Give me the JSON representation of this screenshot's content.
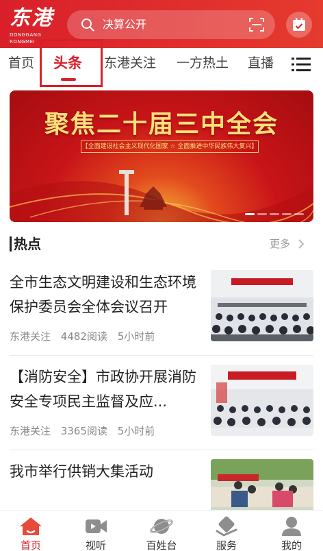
{
  "header": {
    "logo_text": "东港",
    "logo_sub": "DONGGANG RONGMEI",
    "search_placeholder": "决算公开",
    "icons": {
      "search": "search-icon",
      "scan": "scan-icon",
      "calendar": "calendar-icon"
    }
  },
  "tabs": [
    {
      "label": "首页"
    },
    {
      "label": "头条",
      "active": true
    },
    {
      "label": "东港关注"
    },
    {
      "label": "一方热土"
    },
    {
      "label": "直播"
    }
  ],
  "banner": {
    "title": "聚焦二十届三中全会",
    "subtitle": "【全面建设社会主义现代化国家 ☆ 全面推进中华民族伟大复兴】"
  },
  "section": {
    "title": "热点",
    "more": "更多"
  },
  "news": [
    {
      "title": "全市生态文明建设和生态环境保护委员会全体会议召开",
      "source": "东港关注",
      "reads": "4482阅读",
      "time": "5小时前"
    },
    {
      "title": "【消防安全】市政协开展消防安全专项民主监督及应...",
      "source": "东港关注",
      "reads": "3365阅读",
      "time": "5小时前"
    },
    {
      "title": "我市举行供销大集活动",
      "source": "",
      "reads": "",
      "time": ""
    }
  ],
  "bottom_nav": [
    {
      "label": "首页",
      "icon": "home-icon",
      "active": true
    },
    {
      "label": "视听",
      "icon": "video-icon"
    },
    {
      "label": "百姓台",
      "icon": "planet-icon"
    },
    {
      "label": "服务",
      "icon": "service-icon"
    },
    {
      "label": "我的",
      "icon": "user-icon"
    }
  ],
  "colors": {
    "brand": "#d9202a",
    "muted": "#888888"
  }
}
